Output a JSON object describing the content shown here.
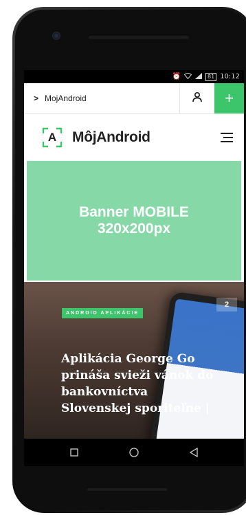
{
  "status_bar": {
    "icons": [
      "alarm-icon",
      "wifi-icon",
      "signal-icon",
      "battery-icon"
    ],
    "battery": "81",
    "time": "10:12"
  },
  "top_bar": {
    "breadcrumb": "MojAndroid",
    "accent": "#3dc56c"
  },
  "header": {
    "logo_letter": "A",
    "logo_text": "MôjAndroid"
  },
  "banner": {
    "line1": "Banner MOBILE",
    "line2": "320x200px",
    "color": "#86d8a6"
  },
  "article": {
    "tag": "ANDROID APLIKÁCIE",
    "count": "2",
    "title": "Aplikácia George Go prináša svieži vánok do bankovníctva Slovenskej sporiteľne |"
  },
  "nav_buttons": [
    "back-icon",
    "home-icon",
    "recents-icon"
  ]
}
